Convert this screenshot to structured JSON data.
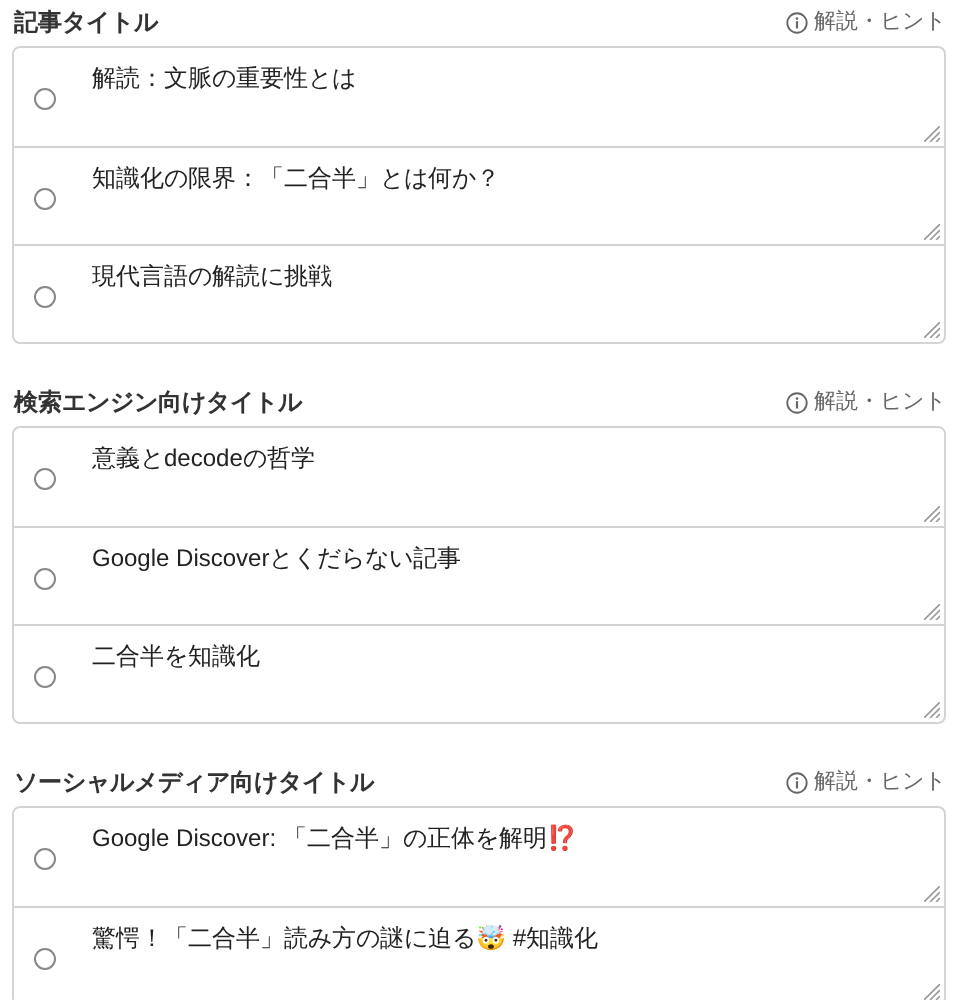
{
  "sections": [
    {
      "heading": "記事タイトル",
      "hint": "解説・ヒント",
      "options": [
        {
          "text": "解読：文脈の重要性とは",
          "selected": false
        },
        {
          "text": "知識化の限界：「二合半」とは何か？",
          "selected": false
        },
        {
          "text": "現代言語の解読に挑戦",
          "selected": false
        }
      ]
    },
    {
      "heading": "検索エンジン向けタイトル",
      "hint": "解説・ヒント",
      "options": [
        {
          "text": "意義とdecodeの哲学",
          "selected": false
        },
        {
          "text": "Google Discoverとくだらない記事",
          "selected": false
        },
        {
          "text": "二合半を知識化",
          "selected": false
        }
      ]
    },
    {
      "heading": "ソーシャルメディア向けタイトル",
      "hint": "解説・ヒント",
      "options": [
        {
          "text": "Google Discover: 「二合半」の正体を解明⁉️",
          "selected": false
        },
        {
          "text": "驚愕！「二合半」読み方の謎に迫る🤯 #知識化",
          "selected": false
        }
      ]
    }
  ]
}
